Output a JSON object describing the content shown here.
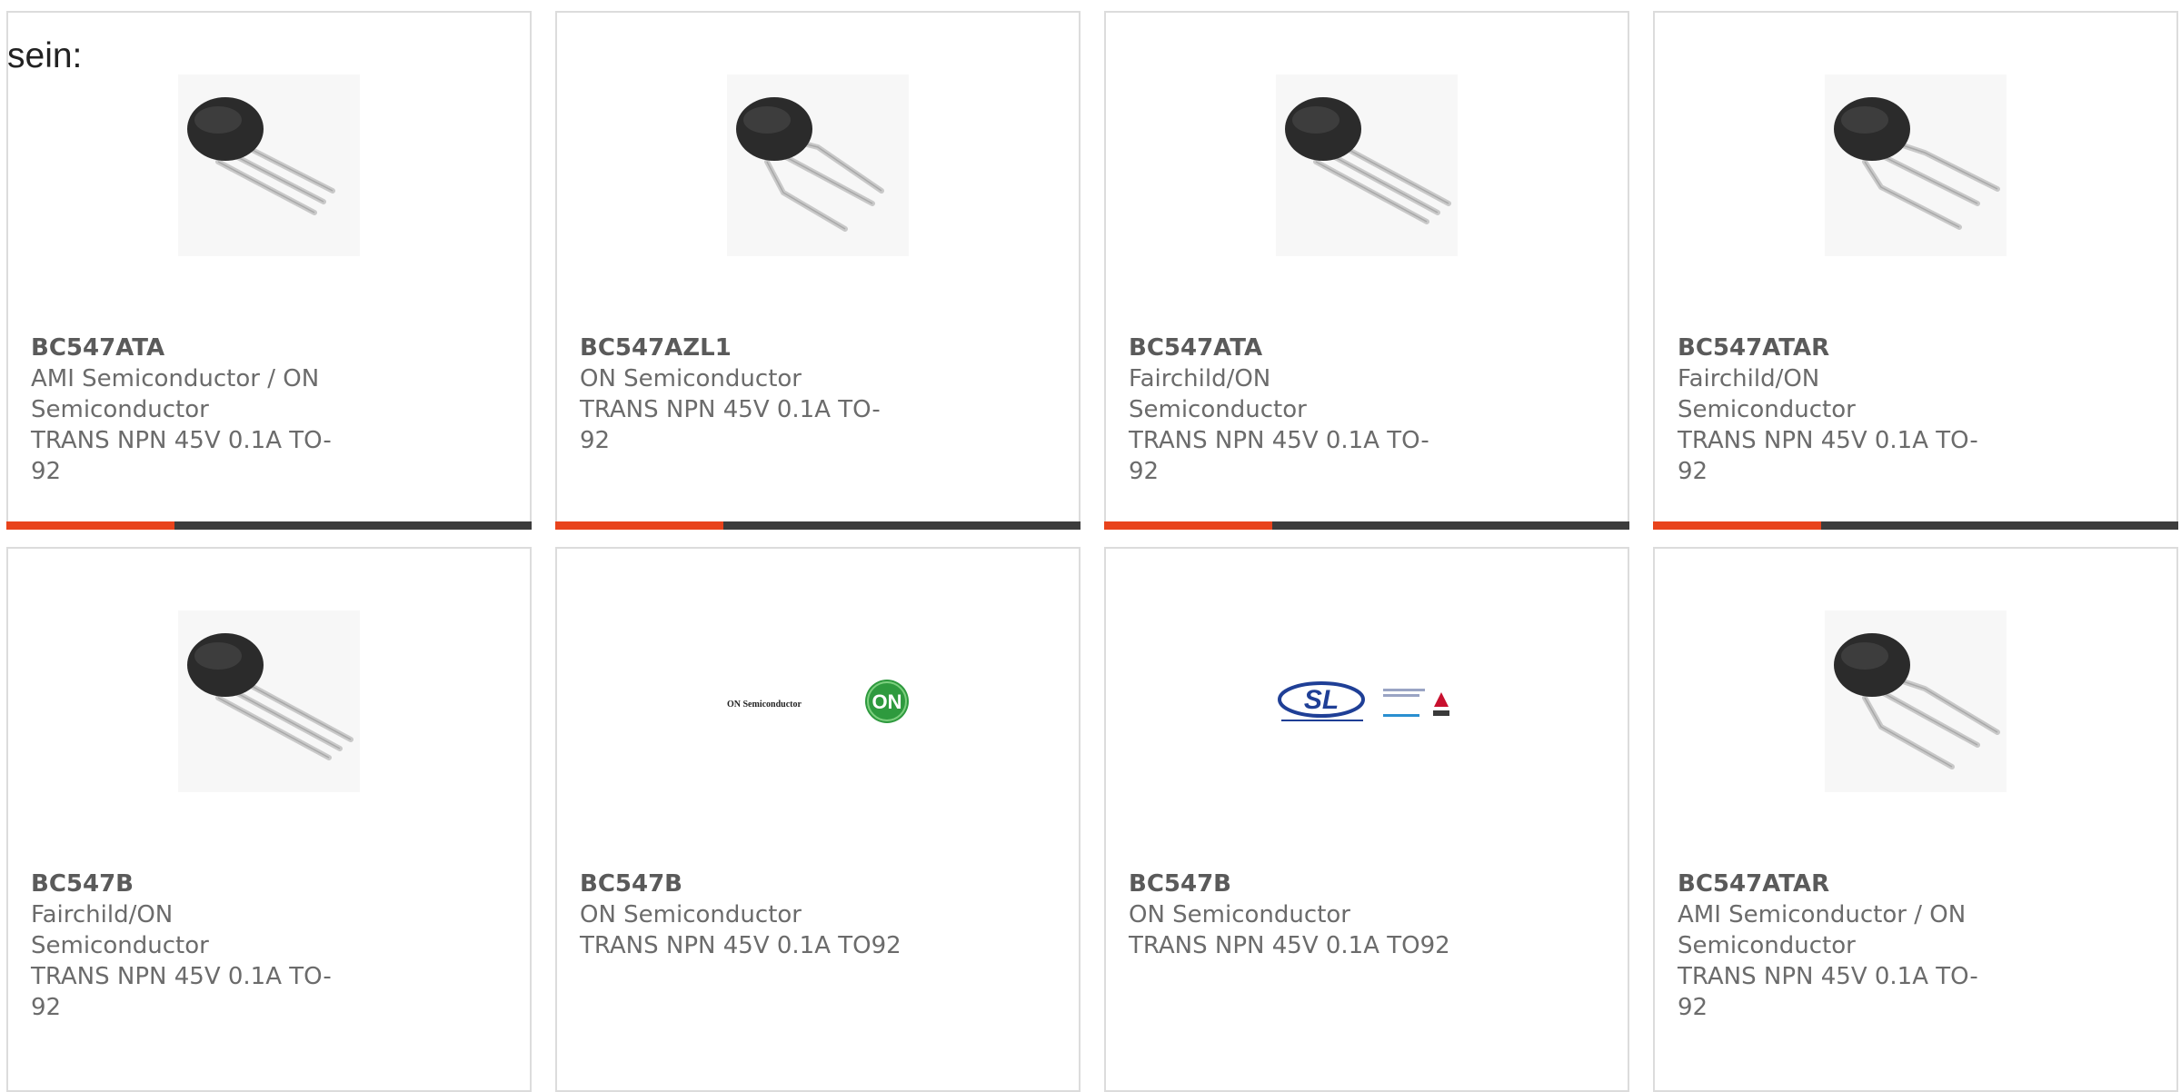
{
  "intro_text": "sein:",
  "accent_color": "#e8431c",
  "products": [
    {
      "part": "BC547ATA",
      "manufacturer": "AMI Semiconductor / ON Semiconductor",
      "description": "TRANS NPN 45V 0.1A TO-92",
      "image": "to92-straight-leads"
    },
    {
      "part": "BC547AZL1",
      "manufacturer": "ON Semiconductor",
      "description": "TRANS NPN 45V 0.1A TO-92",
      "image": "to92-bent-leads"
    },
    {
      "part": "BC547ATA",
      "manufacturer": "Fairchild/ON Semiconductor",
      "description": "TRANS NPN 45V 0.1A TO-92",
      "image": "to92-straight-leads"
    },
    {
      "part": "BC547ATAR",
      "manufacturer": "Fairchild/ON Semiconductor",
      "description": "TRANS NPN 45V 0.1A TO-92",
      "image": "to92-bent-leads"
    },
    {
      "part": "BC547B",
      "manufacturer": "Fairchild/ON Semiconductor",
      "description": "TRANS NPN 45V 0.1A TO-92",
      "image": "to92-straight-leads"
    },
    {
      "part": "BC547B",
      "manufacturer": "ON Semiconductor",
      "description": "TRANS NPN 45V 0.1A TO92",
      "image": "on-semiconductor-logo",
      "logo_text": "ON Semiconductor",
      "logo_badge": "ON"
    },
    {
      "part": "BC547B",
      "manufacturer": "ON Semiconductor",
      "description": "TRANS NPN 45V 0.1A TO92",
      "image": "sl-power-electronics-logo",
      "logo_text": "SL"
    },
    {
      "part": "BC547ATAR",
      "manufacturer": "AMI Semiconductor / ON Semiconductor",
      "description": "TRANS NPN 45V 0.1A TO-92",
      "image": "to92-bent-leads"
    }
  ]
}
